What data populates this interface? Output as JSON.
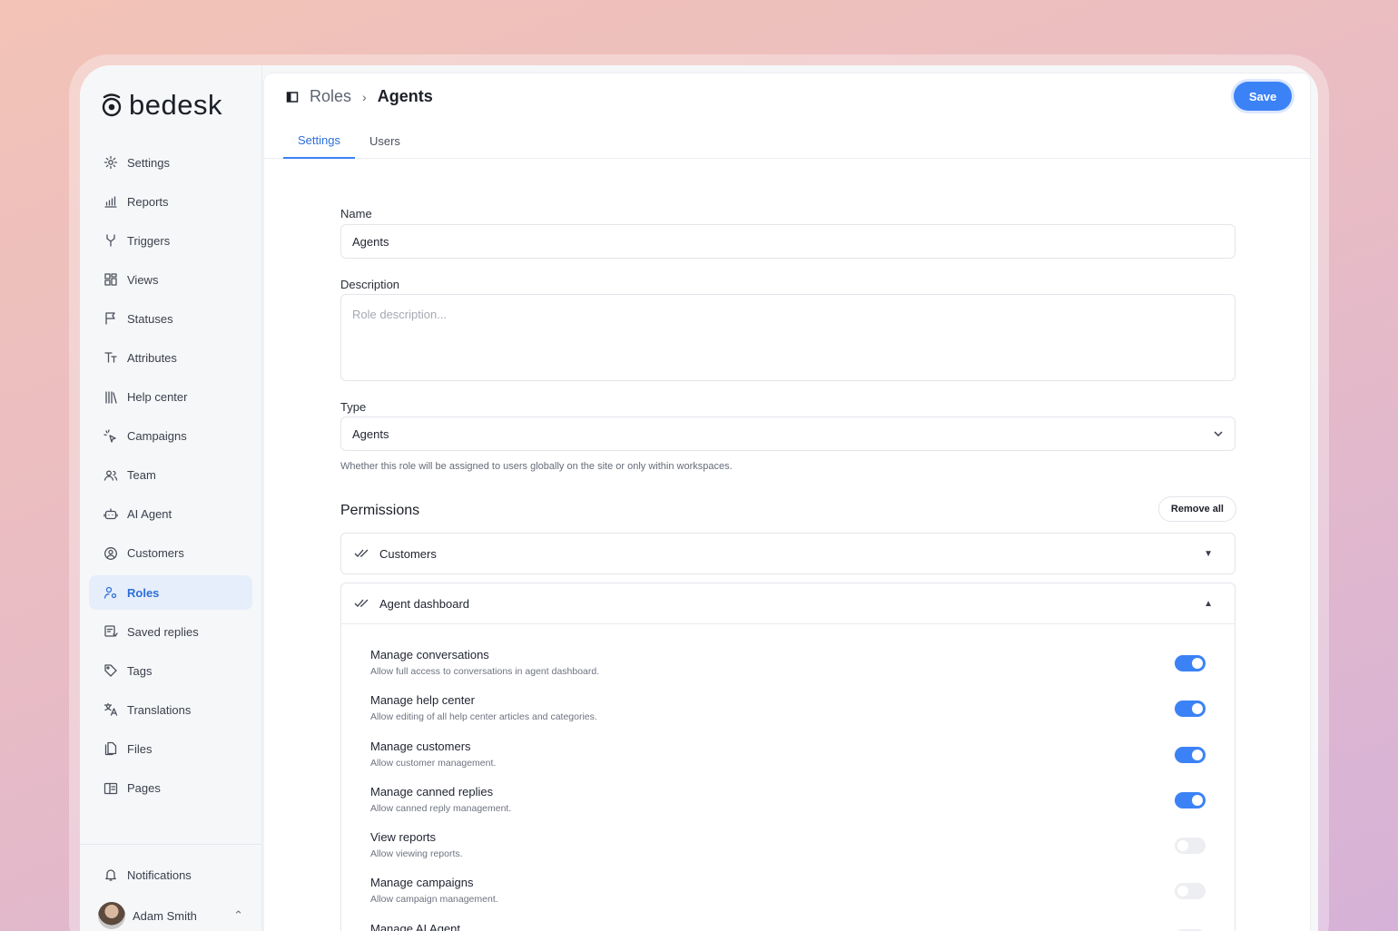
{
  "brand": {
    "name": "bedesk"
  },
  "sidebar": {
    "items": [
      {
        "label": "Settings",
        "icon": "gear-icon"
      },
      {
        "label": "Reports",
        "icon": "chart-icon"
      },
      {
        "label": "Triggers",
        "icon": "branch-icon"
      },
      {
        "label": "Views",
        "icon": "grid-icon"
      },
      {
        "label": "Statuses",
        "icon": "flag-icon"
      },
      {
        "label": "Attributes",
        "icon": "text-icon"
      },
      {
        "label": "Help center",
        "icon": "library-icon"
      },
      {
        "label": "Campaigns",
        "icon": "sparkle-cursor-icon"
      },
      {
        "label": "Team",
        "icon": "users-icon"
      },
      {
        "label": "AI Agent",
        "icon": "bot-icon"
      },
      {
        "label": "Customers",
        "icon": "user-circle-icon"
      },
      {
        "label": "Roles",
        "icon": "user-gear-icon",
        "active": true
      },
      {
        "label": "Saved replies",
        "icon": "saved-reply-icon"
      },
      {
        "label": "Tags",
        "icon": "tag-icon"
      },
      {
        "label": "Translations",
        "icon": "translate-icon"
      },
      {
        "label": "Files",
        "icon": "files-icon"
      },
      {
        "label": "Pages",
        "icon": "pages-icon"
      }
    ],
    "notifications": "Notifications",
    "user": "Adam Smith"
  },
  "header": {
    "breadcrumb_parent": "Roles",
    "breadcrumb_current": "Agents",
    "save_label": "Save",
    "tabs": [
      {
        "label": "Settings",
        "active": true
      },
      {
        "label": "Users"
      }
    ]
  },
  "form": {
    "name_label": "Name",
    "name_value": "Agents",
    "description_label": "Description",
    "description_placeholder": "Role description...",
    "type_label": "Type",
    "type_value": "Agents",
    "type_help": "Whether this role will be assigned to users globally on the site or only within workspaces."
  },
  "permissions": {
    "title": "Permissions",
    "remove_all_label": "Remove all",
    "groups": [
      {
        "name": "Customers",
        "expanded": false
      },
      {
        "name": "Agent dashboard",
        "expanded": true
      }
    ],
    "items": [
      {
        "name": "Manage conversations",
        "desc": "Allow full access to conversations in agent dashboard.",
        "enabled": true
      },
      {
        "name": "Manage help center",
        "desc": "Allow editing of all help center articles and categories.",
        "enabled": true
      },
      {
        "name": "Manage customers",
        "desc": "Allow customer management.",
        "enabled": true
      },
      {
        "name": "Manage canned replies",
        "desc": "Allow canned reply management.",
        "enabled": true
      },
      {
        "name": "View reports",
        "desc": "Allow viewing reports.",
        "enabled": false
      },
      {
        "name": "Manage campaigns",
        "desc": "Allow campaign management.",
        "enabled": false
      },
      {
        "name": "Manage AI Agent",
        "desc": "",
        "enabled": false
      }
    ]
  },
  "colors": {
    "accent": "#3b82f6",
    "active_nav_bg": "#e6eefb"
  }
}
